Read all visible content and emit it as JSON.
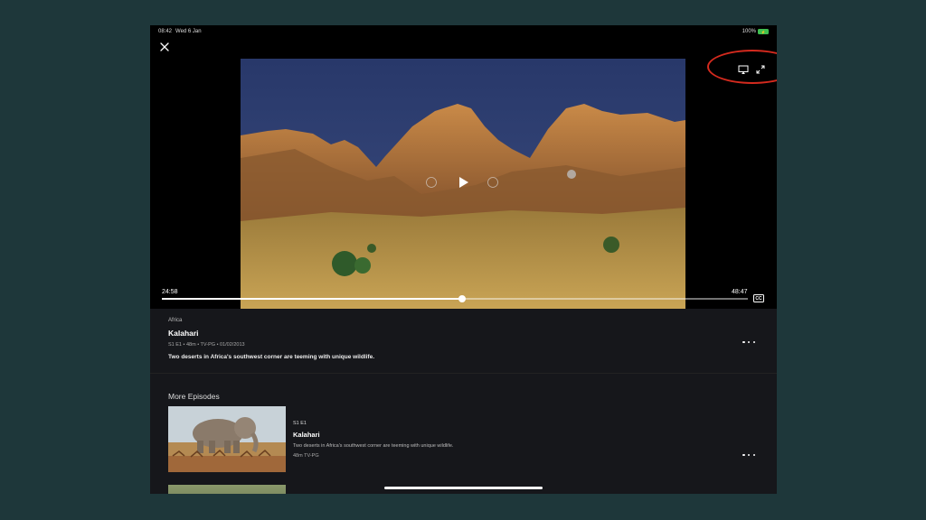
{
  "status": {
    "time": "08:42",
    "date": "Wed 6 Jan",
    "battery_pct": "100%",
    "battery_color": "#3fbf50"
  },
  "player": {
    "close_icon": "close-icon",
    "airplay_icon": "airplay-icon",
    "expand_icon": "expand-icon",
    "current_time": "24:58",
    "total_time": "48:47",
    "progress_fraction": 0.512,
    "cc_label": "CC",
    "highlight_color": "#d42a1e"
  },
  "info": {
    "series": "Africa",
    "title": "Kalahari",
    "meta": "S1 E1  •  48m  •  TV-PG  •  01/02/2013",
    "description": "Two deserts in Africa's southwest corner are teeming with unique wildlife."
  },
  "episodes": {
    "heading": "More Episodes",
    "items": [
      {
        "code": "S1 E1",
        "title": "Kalahari",
        "description": "Two deserts in Africa's southwest corner are teeming with unique wildlife.",
        "meta": "48m  TV-PG"
      }
    ]
  }
}
